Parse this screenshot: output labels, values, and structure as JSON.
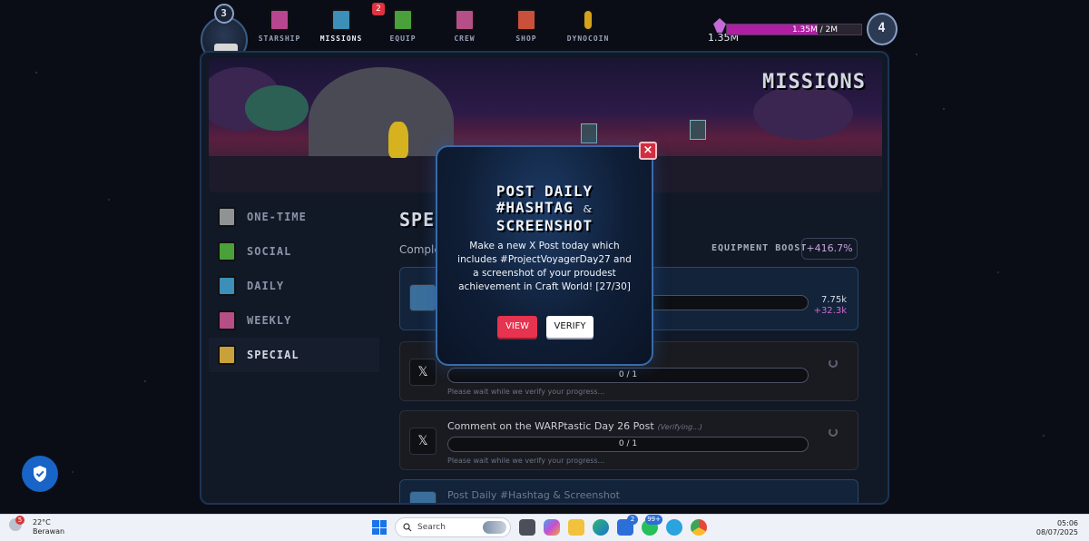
{
  "player": {
    "level": "3"
  },
  "nav": {
    "items": [
      {
        "label": "STARSHIP",
        "icon": "starship-icon",
        "color": "#b8468f"
      },
      {
        "label": "MISSIONS",
        "icon": "missions-icon",
        "color": "#3b8fb8"
      },
      {
        "label": "EQUIP",
        "icon": "equip-icon",
        "color": "#4aa03b",
        "badge": "2"
      },
      {
        "label": "CREW",
        "icon": "crew-icon",
        "color": "#b54f86"
      },
      {
        "label": "SHOP",
        "icon": "shop-icon",
        "color": "#c9503a"
      },
      {
        "label": "DYNOCOIN",
        "icon": "dynocoin-icon",
        "color": "#d4a21d"
      }
    ]
  },
  "xp": {
    "current": "1.35M",
    "bar_text": "1.35M / 2M",
    "progress": 0.675,
    "next_level": "4"
  },
  "banner": {
    "title": "MISSIONS"
  },
  "sidebar": {
    "items": [
      {
        "label": "ONE-TIME",
        "color": "#8f9396"
      },
      {
        "label": "SOCIAL",
        "color": "#4aa03b"
      },
      {
        "label": "DAILY",
        "color": "#3b8fb8"
      },
      {
        "label": "WEEKLY",
        "color": "#b54f86"
      },
      {
        "label": "SPECIAL",
        "color": "#c9a13a"
      }
    ]
  },
  "content": {
    "title": "SPECIAL",
    "subtitle": "Comple",
    "boost_label": "EQUIPMENT BOOST",
    "boost_value": "+416.7%"
  },
  "missions": [
    {
      "title": "",
      "progress": "",
      "note": "",
      "reward_main": "7.75k",
      "reward_bonus": "+32.3k",
      "icon": "journal-icon"
    },
    {
      "title": "",
      "status": "",
      "progress": "0 / 1",
      "note": "Please wait while we verify your progress...",
      "icon": "x-logo-icon"
    },
    {
      "title": "Comment on the WARPtastic Day 26 Post",
      "status": "(Verifying...)",
      "progress": "0 / 1",
      "note": "Please wait while we verify your progress...",
      "icon": "x-logo-icon"
    },
    {
      "title": "Post Daily #Hashtag & Screenshot",
      "icon": "journal-icon"
    }
  ],
  "modal": {
    "title_line1": "POST DAILY",
    "title_line2": "#HASHTAG",
    "title_amp": "&",
    "title_line3": "SCREENSHOT",
    "body": "Make a new X Post today which includes #ProjectVoyagerDay27 and a screenshot of your proudest achievement in Craft World! [27/30]",
    "close": "×",
    "view_label": "VIEW",
    "verify_label": "VERIFY"
  },
  "taskbar": {
    "weather_badge": "5",
    "temperature": "22°C",
    "condition": "Berawan",
    "search_label": "Search",
    "badge_store": "2",
    "badge_whatsapp": "99+",
    "time": "05:06",
    "date": "08/07/2025"
  }
}
